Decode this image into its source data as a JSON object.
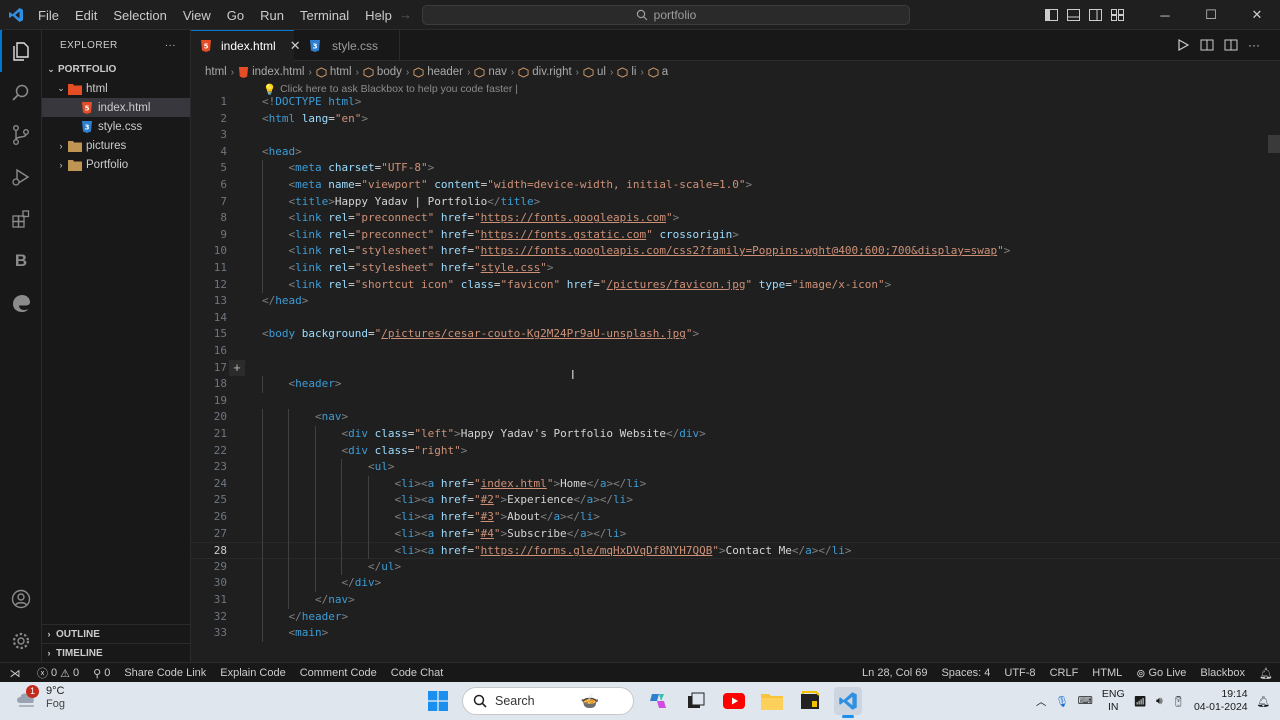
{
  "titlebar": {
    "menu": [
      "File",
      "Edit",
      "Selection",
      "View",
      "Go",
      "Run",
      "Terminal",
      "Help"
    ],
    "search_text": "portfolio"
  },
  "explorer": {
    "title": "EXPLORER",
    "more": "···",
    "root": "PORTFOLIO",
    "items": [
      {
        "label": "html",
        "type": "folder-open"
      },
      {
        "label": "index.html",
        "type": "html-file"
      },
      {
        "label": "style.css",
        "type": "css-file"
      },
      {
        "label": "pictures",
        "type": "folder"
      },
      {
        "label": "Portfolio",
        "type": "folder"
      }
    ],
    "outline": "OUTLINE",
    "timeline": "TIMELINE"
  },
  "tabs": [
    {
      "label": "index.html",
      "active": true
    },
    {
      "label": "style.css",
      "active": false
    }
  ],
  "breadcrumb": [
    "html",
    "index.html",
    "html",
    "body",
    "header",
    "nav",
    "div.right",
    "ul",
    "li",
    "a"
  ],
  "editor": {
    "hint": "Click here to ask Blackbox to help you code faster |",
    "current_line": 28,
    "lines": [
      "<!DOCTYPE html>",
      "<html lang=\"en\">",
      "",
      "<head>",
      "    <meta charset=\"UTF-8\">",
      "    <meta name=\"viewport\" content=\"width=device-width, initial-scale=1.0\">",
      "    <title>Happy Yadav | Portfolio</title>",
      "    <link rel=\"preconnect\" href=\"https://fonts.googleapis.com\">",
      "    <link rel=\"preconnect\" href=\"https://fonts.gstatic.com\" crossorigin>",
      "    <link rel=\"stylesheet\" href=\"https://fonts.googleapis.com/css2?family=Poppins:wght@400;600;700&display=swap\">",
      "    <link rel=\"stylesheet\" href=\"style.css\">",
      "    <link rel=\"shortcut icon\" class=\"favicon\" href=\"/pictures/favicon.jpg\" type=\"image/x-icon\">",
      "</head>",
      "",
      "<body background=\"/pictures/cesar-couto-Kg2M24Pr9aU-unsplash.jpg\">",
      "",
      "",
      "    <header>",
      "",
      "        <nav>",
      "            <div class=\"left\">Happy Yadav's Portfolio Website</div>",
      "            <div class=\"right\">",
      "                <ul>",
      "                    <li><a href=\"index.html\">Home</a></li>",
      "                    <li><a href=\"#2\">Experience</a></li>",
      "                    <li><a href=\"#3\">About</a></li>",
      "                    <li><a href=\"#4\">Subscribe</a></li>",
      "                    <li><a href=\"https://forms.gle/mqHxDVqDf8NYH7QQB\">Contact Me</a></li>",
      "                </ul>",
      "            </div>",
      "        </nav>",
      "    </header>",
      "    <main>"
    ]
  },
  "statusbar": {
    "errors": "0",
    "warnings": "0",
    "ports": "0",
    "left_items": [
      "Share Code Link",
      "Explain Code",
      "Comment Code",
      "Code Chat"
    ],
    "position": "Ln 28, Col 69",
    "spaces": "Spaces: 4",
    "encoding": "UTF-8",
    "eol": "CRLF",
    "language": "HTML",
    "golive": "Go Live",
    "blackbox": "Blackbox"
  },
  "taskbar": {
    "temp": "9°C",
    "weather": "Fog",
    "weather_badge": "1",
    "search": "Search",
    "lang_top": "ENG",
    "lang_bottom": "IN",
    "time": "19:14",
    "date": "04-01-2024"
  },
  "colors": {
    "accent": "#0078d4",
    "tag": "#3c9cd6",
    "attr": "#9cdcfe",
    "string": "#ce9178"
  }
}
